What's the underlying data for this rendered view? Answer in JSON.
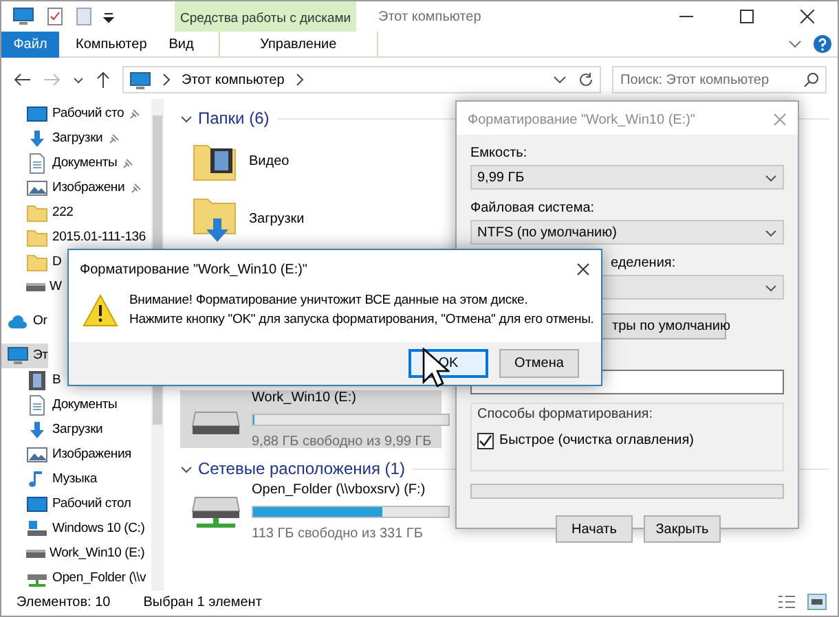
{
  "window": {
    "title": "Этот компьютер",
    "context_group": "Средства работы с дисками"
  },
  "ribbon_tabs": [
    {
      "label": "Файл",
      "kind": "file"
    },
    {
      "label": "Компьютер",
      "kind": "normal"
    },
    {
      "label": "Вид",
      "kind": "normal"
    },
    {
      "label": "Управление",
      "kind": "context"
    }
  ],
  "address": {
    "path": "Этот компьютер"
  },
  "search": {
    "placeholder": "Поиск: Этот компьютер"
  },
  "sidebar": {
    "items": [
      {
        "children": [
          {
            "label": "Рабочий сто",
            "kind": "desktop",
            "pinned": true,
            "selected": false
          },
          {
            "label": "Загрузки",
            "kind": "downloads",
            "pinned": true,
            "selected": false
          },
          {
            "label": "Документы",
            "kind": "documents",
            "pinned": true,
            "selected": false
          },
          {
            "label": "Изображени",
            "kind": "pictures",
            "pinned": true,
            "selected": false
          },
          {
            "label": "222",
            "kind": "folder",
            "pinned": false,
            "selected": false
          },
          {
            "label": "2015.01-111-136",
            "kind": "folder",
            "pinned": false,
            "selected": false
          },
          {
            "label": "D",
            "kind": "folder",
            "pinned": false,
            "selected": false
          },
          {
            "label": "W",
            "kind": "drive",
            "pinned": false,
            "selected": false
          }
        ]
      },
      {
        "label": "Or",
        "kind": "cloud",
        "pinned": false,
        "selected": false
      },
      {
        "label": "Эт",
        "kind": "computer",
        "pinned": false,
        "selected": true,
        "children": [
          {
            "label": "В",
            "kind": "videos",
            "pinned": false,
            "selected": false
          },
          {
            "label": "Документы",
            "kind": "documents",
            "pinned": false,
            "selected": false
          },
          {
            "label": "Загрузки",
            "kind": "downloads",
            "pinned": false,
            "selected": false
          },
          {
            "label": "Изображения",
            "kind": "pictures",
            "pinned": false,
            "selected": false
          },
          {
            "label": "Музыка",
            "kind": "music",
            "pinned": false,
            "selected": false
          },
          {
            "label": "Рабочий стол",
            "kind": "desktop",
            "pinned": false,
            "selected": false
          },
          {
            "label": "Windows 10 (C:)",
            "kind": "system-drive",
            "pinned": false,
            "selected": false
          },
          {
            "label": "Work_Win10 (E:)",
            "kind": "drive",
            "pinned": false,
            "selected": false
          },
          {
            "label": "Open_Folder (\\\\v",
            "kind": "network",
            "pinned": false,
            "selected": false
          }
        ]
      }
    ]
  },
  "content": {
    "sections": [
      {
        "header": "Папки (6)",
        "tiles": [
          {
            "kind": "videos",
            "name": "Видео"
          },
          {
            "kind": "downloads",
            "name": "Загрузки"
          }
        ]
      },
      {
        "tiles": [
          {
            "kind": "drive",
            "name": "Work_Win10 (E:)",
            "level": 0.01,
            "free": "9,88 ГБ свободно из 9,99 ГБ",
            "selected": true
          }
        ]
      },
      {
        "header": "Сетевые расположения (1)",
        "tiles": [
          {
            "kind": "network",
            "name": "Open_Folder (\\\\vboxsrv) (F:)",
            "level": 0.66,
            "free": "113 ГБ свободно из 331 ГБ",
            "selected": false
          }
        ]
      }
    ]
  },
  "status_bar": [
    "Элементов: 10",
    "Выбран 1 элемент"
  ],
  "format_dialog": {
    "title": "Форматирование \"Work_Win10 (E:)\"",
    "selects": [
      {
        "label": "Емкость:",
        "value": "9,99 ГБ"
      },
      {
        "label": "Файловая система:",
        "value": "NTFS (по умолчанию)"
      },
      {
        "label": "еделения:"
      }
    ],
    "restore_button": "тры по умолчанию",
    "options_title": "Способы форматирования:",
    "checkboxes": [
      {
        "label": "Быстрое (очистка оглавления)",
        "checked": true
      }
    ],
    "progress": {
      "level": 0
    },
    "buttons": [
      "Начать",
      "Закрыть"
    ]
  },
  "confirm_dialog": {
    "title": "Форматирование \"Work_Win10 (E:)\"",
    "message": [
      "Внимание! Форматирование уничтожит ВСЕ данные на этом диске.",
      "Нажмите кнопку \"OK\" для запуска форматирования, \"Отмена\" для его отмены."
    ],
    "buttons": [
      {
        "label": "OK",
        "selected": true
      },
      {
        "label": "Отмена",
        "selected": false
      }
    ]
  }
}
